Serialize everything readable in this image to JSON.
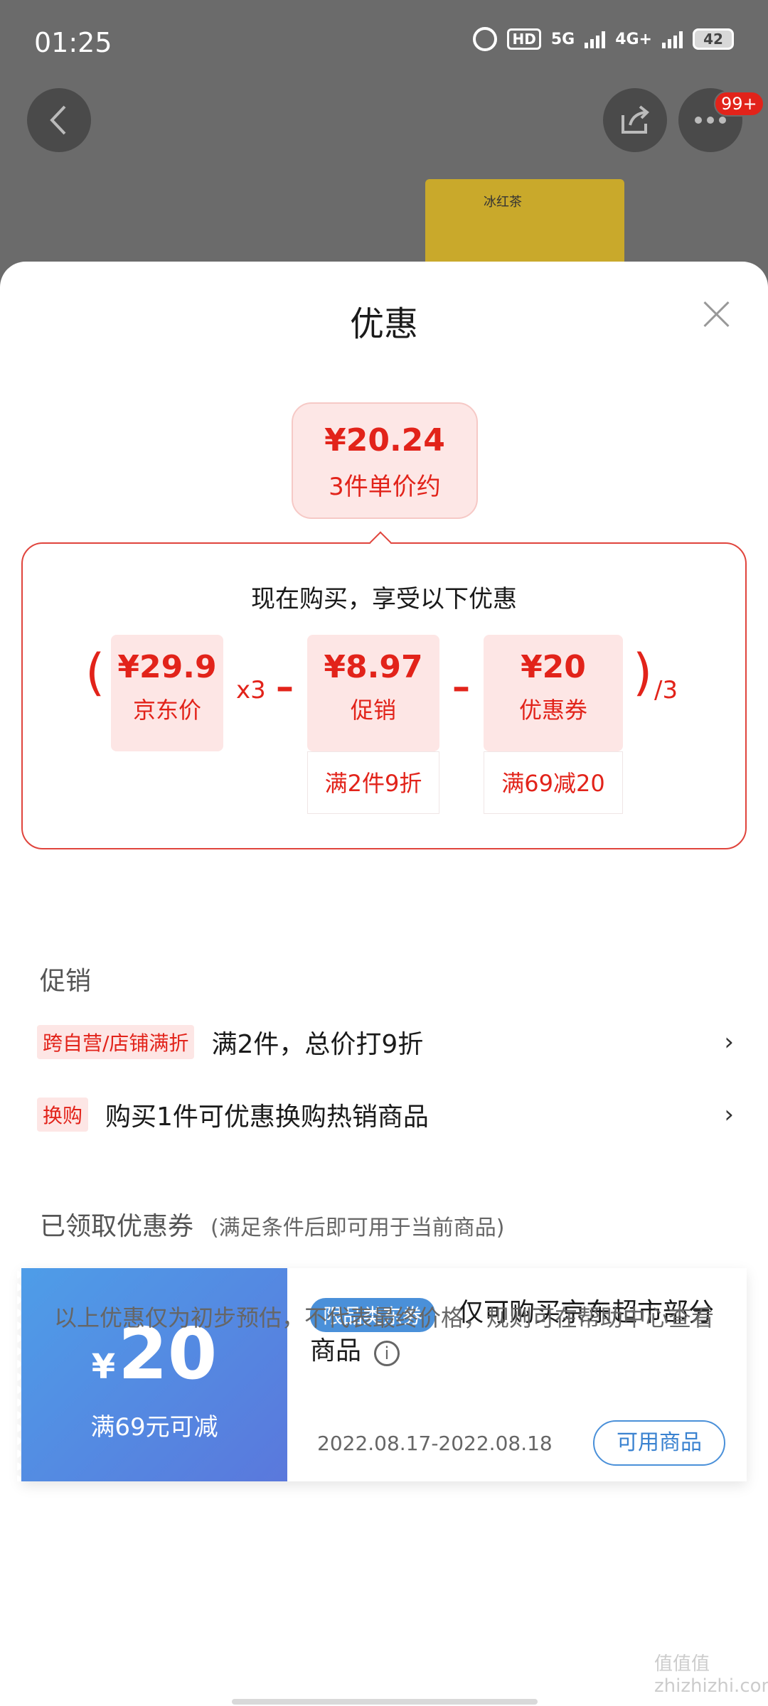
{
  "status_bar": {
    "time": "01:25",
    "hd": "HD",
    "net1": "5G",
    "net2": "4G+",
    "battery": "42"
  },
  "header": {
    "badge": "99+"
  },
  "product": {
    "box_text": "冰红茶"
  },
  "sheet": {
    "title": "优惠"
  },
  "unit_price": {
    "price": "¥20.24",
    "label": "3件单价约"
  },
  "calculation": {
    "heading": "现在购买，享受以下优惠",
    "open_paren": "(",
    "close_paren": ")",
    "jd_price": {
      "value": "¥29.9",
      "label": "京东价"
    },
    "multiplier": "x3",
    "minus": "–",
    "promo": {
      "value": "¥8.97",
      "label": "促销",
      "condition": "满2件9折"
    },
    "coupon": {
      "value": "¥20",
      "label": "优惠券",
      "condition": "满69减20"
    },
    "divisor": "/3"
  },
  "promotions": {
    "title": "促销",
    "items": [
      {
        "tag": "跨自营/店铺满折",
        "text": "满2件，总价打9折"
      },
      {
        "tag": "换购",
        "text": "购买1件可优惠换购热销商品"
      }
    ],
    "chevron": "›"
  },
  "coupons": {
    "title": "已领取优惠券",
    "subtitle": "(满足条件后即可用于当前商品)",
    "items": [
      {
        "currency": "¥",
        "amount": "20",
        "condition": "满69元可减",
        "tag": "限品类东券",
        "description": "仅可购买京东超市部分商品",
        "date": "2022.08.17-2022.08.18",
        "button": "可用商品"
      }
    ]
  },
  "footer": {
    "note": "以上优惠仅为初步预估，不代表最终价格，规则可在帮助中心查看",
    "info": "i"
  },
  "watermark": "值值值 zhizhizhi.com"
}
